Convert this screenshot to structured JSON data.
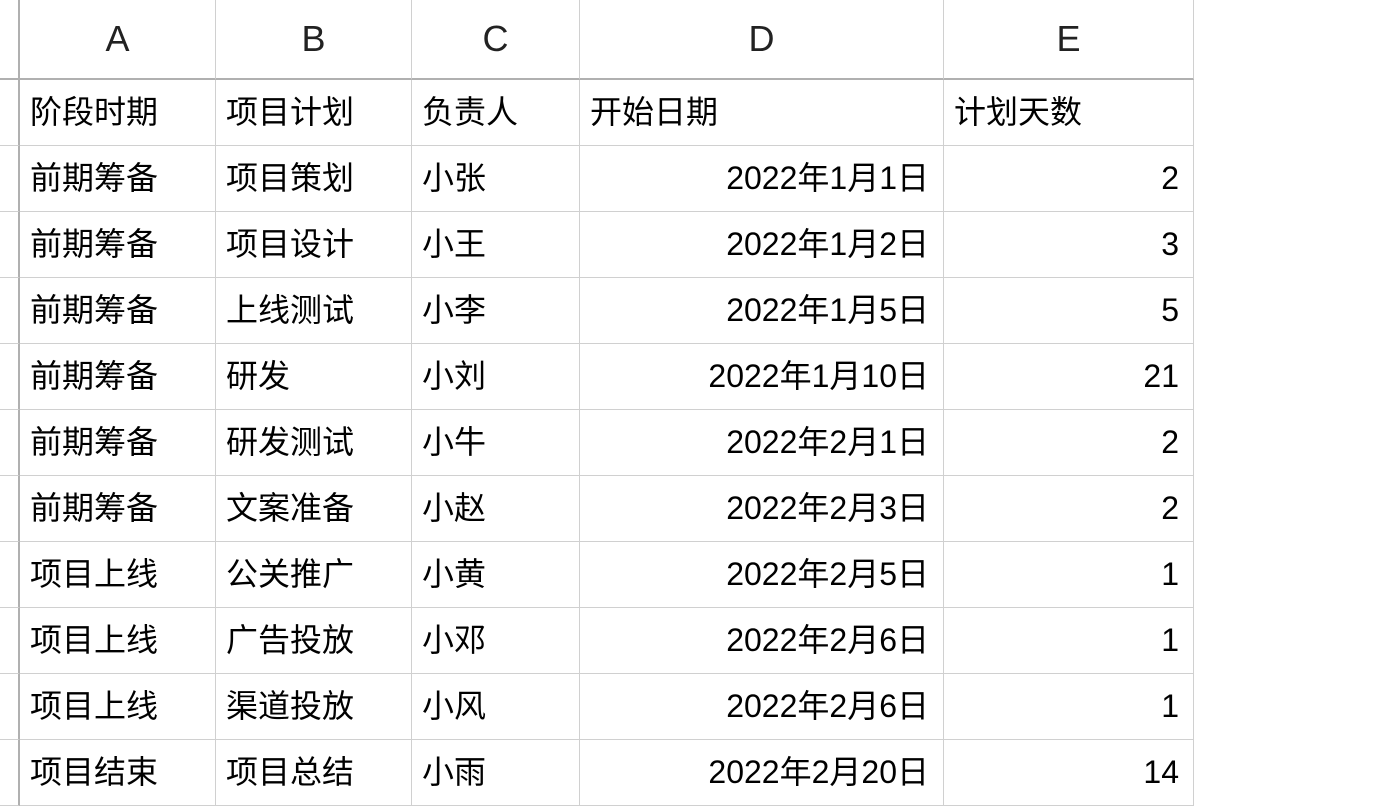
{
  "columns": [
    "A",
    "B",
    "C",
    "D",
    "E"
  ],
  "headers": {
    "phase": "阶段时期",
    "plan": "项目计划",
    "owner": "负责人",
    "start_date": "开始日期",
    "days": "计划天数"
  },
  "rows": [
    {
      "phase": "前期筹备",
      "plan": "项目策划",
      "owner": "小张",
      "start_date": "2022年1月1日",
      "days": "2"
    },
    {
      "phase": "前期筹备",
      "plan": "项目设计",
      "owner": "小王",
      "start_date": "2022年1月2日",
      "days": "3"
    },
    {
      "phase": "前期筹备",
      "plan": "上线测试",
      "owner": "小李",
      "start_date": "2022年1月5日",
      "days": "5"
    },
    {
      "phase": "前期筹备",
      "plan": "研发",
      "owner": "小刘",
      "start_date": "2022年1月10日",
      "days": "21"
    },
    {
      "phase": "前期筹备",
      "plan": "研发测试",
      "owner": "小牛",
      "start_date": "2022年2月1日",
      "days": "2"
    },
    {
      "phase": "前期筹备",
      "plan": "文案准备",
      "owner": "小赵",
      "start_date": "2022年2月3日",
      "days": "2"
    },
    {
      "phase": "项目上线",
      "plan": "公关推广",
      "owner": "小黄",
      "start_date": "2022年2月5日",
      "days": "1"
    },
    {
      "phase": "项目上线",
      "plan": "广告投放",
      "owner": "小邓",
      "start_date": "2022年2月6日",
      "days": "1"
    },
    {
      "phase": "项目上线",
      "plan": "渠道投放",
      "owner": "小风",
      "start_date": "2022年2月6日",
      "days": "1"
    },
    {
      "phase": "项目结束",
      "plan": "项目总结",
      "owner": "小雨",
      "start_date": "2022年2月20日",
      "days": "14"
    }
  ]
}
